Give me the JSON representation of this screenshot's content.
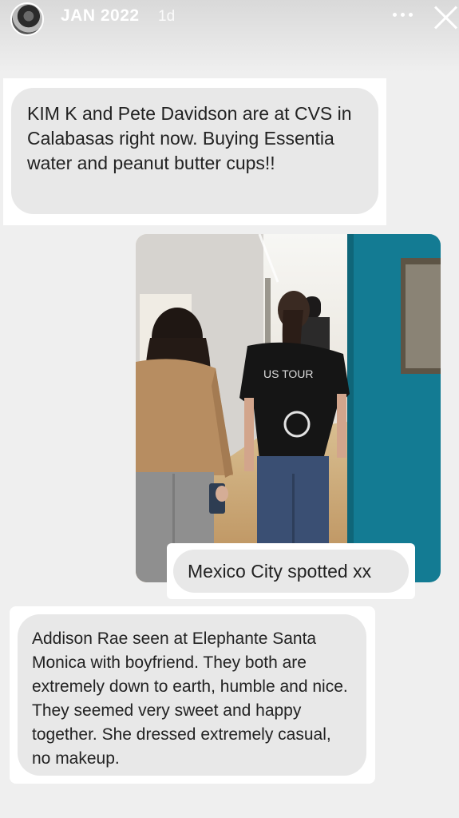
{
  "story": {
    "title": "JAN 2022",
    "age": "1d"
  },
  "messages": {
    "first": "KIM K and Pete Davidson are at CVS in Calabasas right now. Buying Essentia water and peanut butter cups!!",
    "photo_caption": "Mexico City spotted xx",
    "second": "Addison Rae seen at Elephante Santa Monica with boyfriend. They both are extremely down to earth, humble and nice. They seemed very sweet and happy together. She dressed extremely casual, no makeup."
  },
  "colors": {
    "bubble": "#e8e8e8",
    "background": "#efefef",
    "photo_wall": "#167a91"
  }
}
